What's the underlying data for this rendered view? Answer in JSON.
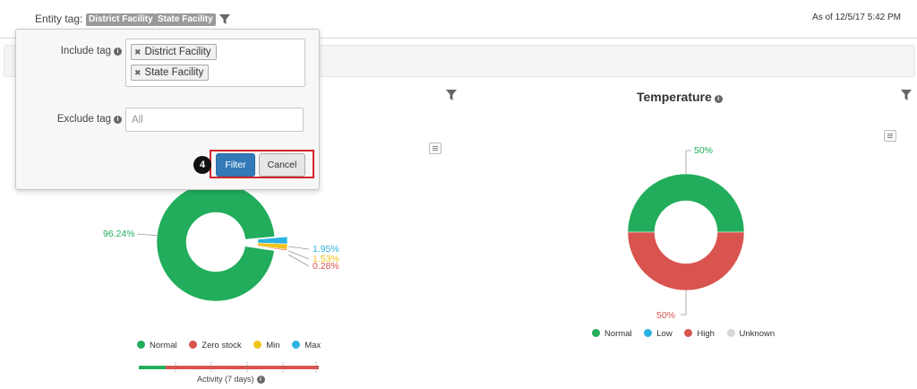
{
  "header": {
    "entity_tag_label": "Entity tag:",
    "tags": [
      "District Facility",
      "State Facility"
    ],
    "as_of": "As of 12/5/17 5:42 PM"
  },
  "popover": {
    "include_label": "Include tag",
    "include_tags": [
      "District Facility",
      "State Facility"
    ],
    "exclude_label": "Exclude tag",
    "exclude_placeholder": "All",
    "filter_button": "Filter",
    "cancel_button": "Cancel",
    "step_number": "4"
  },
  "stock_chart": {
    "legend": [
      "Normal",
      "Zero stock",
      "Min",
      "Max"
    ],
    "activity_label": "Activity (7 days)"
  },
  "temperature_chart": {
    "title": "Temperature",
    "legend": [
      "Normal",
      "Low",
      "High",
      "Unknown"
    ]
  },
  "colors": {
    "normal": "#21ad5b",
    "zero_stock": "#d9534f",
    "min": "#f0c419",
    "max": "#2ab3e2",
    "low": "#2ab3e2",
    "high": "#d9534f",
    "unknown": "#d6d6d6",
    "highlight": "#d0262b"
  },
  "chart_data": [
    {
      "type": "pie",
      "categories": [
        "Normal",
        "Zero stock",
        "Min",
        "Max"
      ],
      "values": [
        96.24,
        0.28,
        1.53,
        1.95
      ],
      "labels": [
        "96.24%",
        "0.28%",
        "1.53%",
        "1.95%"
      ]
    },
    {
      "type": "pie",
      "title": "Temperature",
      "categories": [
        "Normal",
        "Low",
        "High",
        "Unknown"
      ],
      "values": [
        50,
        0,
        50,
        0
      ],
      "labels": [
        "50%",
        "50%"
      ]
    }
  ]
}
